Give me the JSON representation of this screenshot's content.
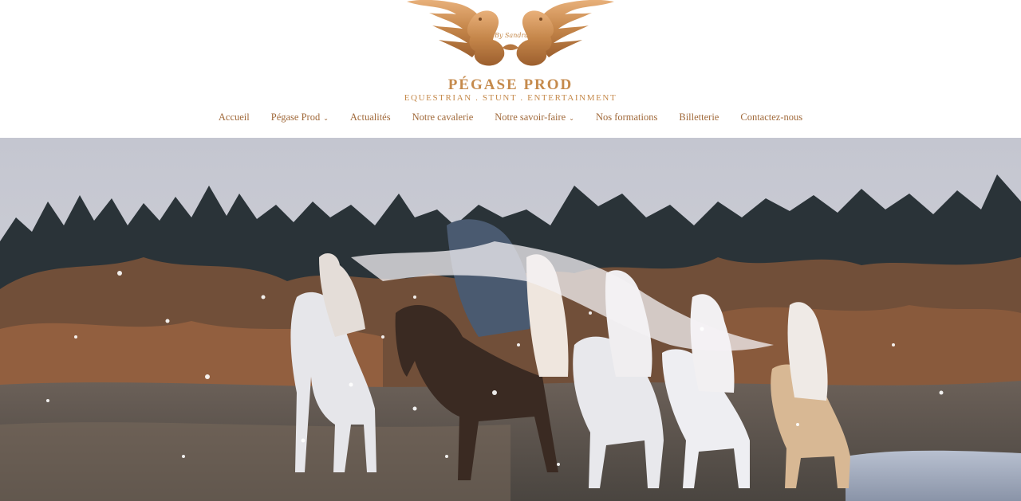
{
  "brand": {
    "name": "PÉGASE PROD",
    "tagline": "EQUESTRIAN . STUNT . ENTERTAINMENT",
    "signature": "By Sandra",
    "logo_icon": "winged-horses-emblem-icon",
    "accent_color": "#c58a4c"
  },
  "nav": {
    "items": [
      {
        "label": "Accueil",
        "has_dropdown": false
      },
      {
        "label": "Pégase Prod",
        "has_dropdown": true
      },
      {
        "label": "Actualités",
        "has_dropdown": false
      },
      {
        "label": "Notre cavalerie",
        "has_dropdown": false
      },
      {
        "label": "Notre savoir-faire",
        "has_dropdown": true
      },
      {
        "label": "Nos formations",
        "has_dropdown": false
      },
      {
        "label": "Billetterie",
        "has_dropdown": false
      },
      {
        "label": "Contactez-nous",
        "has_dropdown": false
      }
    ],
    "dropdown_icon": "chevron-down-icon",
    "text_color": "#a0693a"
  }
}
